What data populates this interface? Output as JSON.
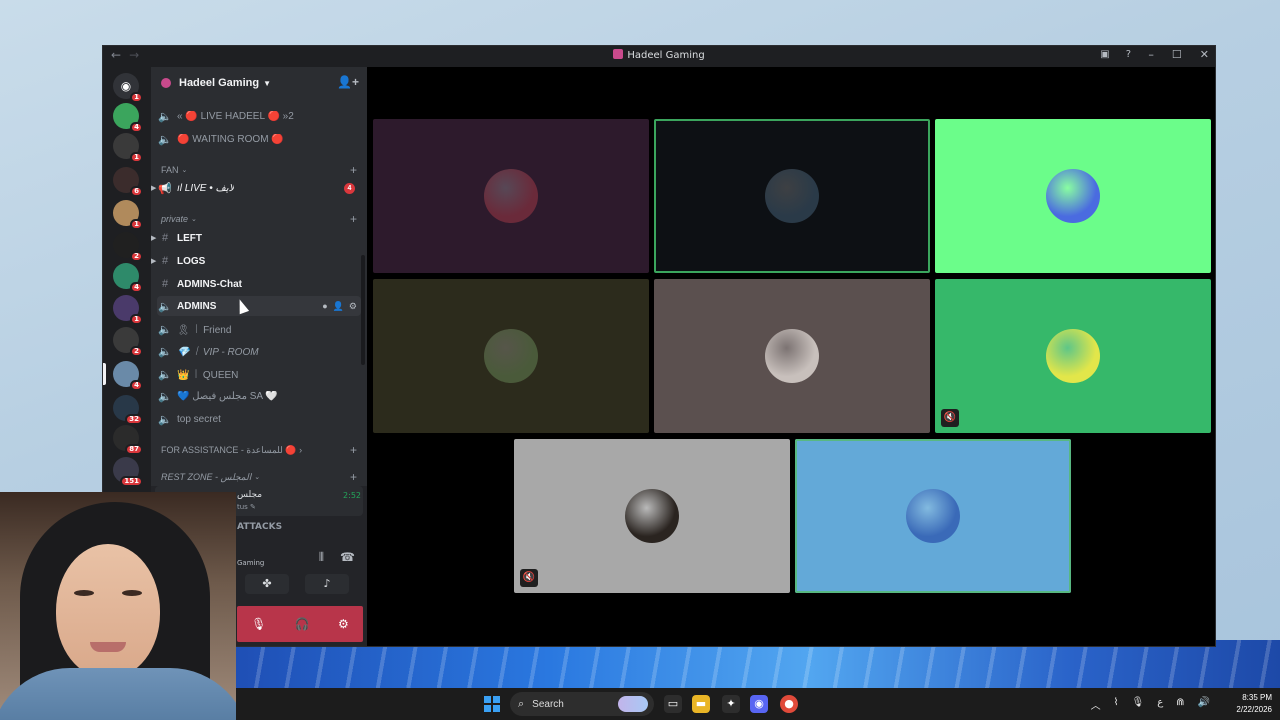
{
  "window": {
    "title": "Hadeel Gaming",
    "nav_back": "←",
    "nav_forward": "→"
  },
  "server": {
    "name": "Hadeel Gaming",
    "rail_badges": [
      "1",
      "4",
      "1",
      "6",
      "1",
      "2",
      "4",
      "1",
      "2",
      "4",
      "32",
      "87",
      "151"
    ]
  },
  "channels": {
    "items": [
      {
        "label": "« 🔴 LIVE HADEEL 🔴 »2",
        "type": "voice"
      },
      {
        "label": "🔴 WAITING ROOM 🔴",
        "type": "voice"
      },
      {
        "label": "ıl LIVE • لايف",
        "type": "stage",
        "count": "4"
      },
      {
        "label": "LEFT",
        "type": "text"
      },
      {
        "label": "LOGS",
        "type": "text"
      },
      {
        "label": "ADMINS-Chat",
        "type": "text"
      },
      {
        "label": "ADMINS",
        "type": "voice"
      },
      {
        "label": "🎗 ꒐ Friend",
        "type": "voice"
      },
      {
        "label": "💎 ꒐ VIP - ROOM",
        "type": "voice"
      },
      {
        "label": "👑 ꒐ QUEEN",
        "type": "voice"
      },
      {
        "label": "💙 مجلس فيصل SA 🤍",
        "type": "voice"
      },
      {
        "label": "top secret",
        "type": "voice"
      }
    ],
    "categories": {
      "fan": "FAN",
      "private": "private",
      "assistance": "FOR ASSISTANCE - للمساعدة 🔴 ›",
      "rest": "REST ZONE - المجلس"
    }
  },
  "voice_panel": {
    "channel": "مجلس",
    "time": "2:52",
    "status": "tus ✎",
    "heading": "ATTACKS",
    "server": "Gaming"
  },
  "video": {
    "tiles": [
      {
        "bg": "#2d1a2c",
        "avatar": "#6a2a3a",
        "speaking": false,
        "muted": false
      },
      {
        "bg": "#0d1014",
        "avatar": "#2a3a48",
        "speaking": true,
        "muted": false
      },
      {
        "bg": "#6bfd8a",
        "avatar": "#4a6be0",
        "speaking": false,
        "muted": false
      },
      {
        "bg": "#2c2b1c",
        "avatar": "#4a5a3a",
        "speaking": false,
        "muted": false
      },
      {
        "bg": "#5b504f",
        "avatar": "#c8c0bc",
        "speaking": false,
        "muted": false
      },
      {
        "bg": "#36b86a",
        "avatar": "#e2e64a",
        "speaking": false,
        "muted": true
      },
      {
        "bg": "#a8a8a8",
        "avatar": "#2a2420",
        "speaking": false,
        "muted": true
      },
      {
        "bg": "#63a9d8",
        "avatar": "#3a6ab8",
        "speaking": true,
        "muted": false
      }
    ]
  },
  "taskbar": {
    "search_label": "Search",
    "time": "8:35 PM",
    "date": "2/22/2026",
    "lang": "ع"
  },
  "colors": {
    "accent": "#5865f2",
    "speaking": "#3ba55d",
    "badge": "#da373c"
  }
}
